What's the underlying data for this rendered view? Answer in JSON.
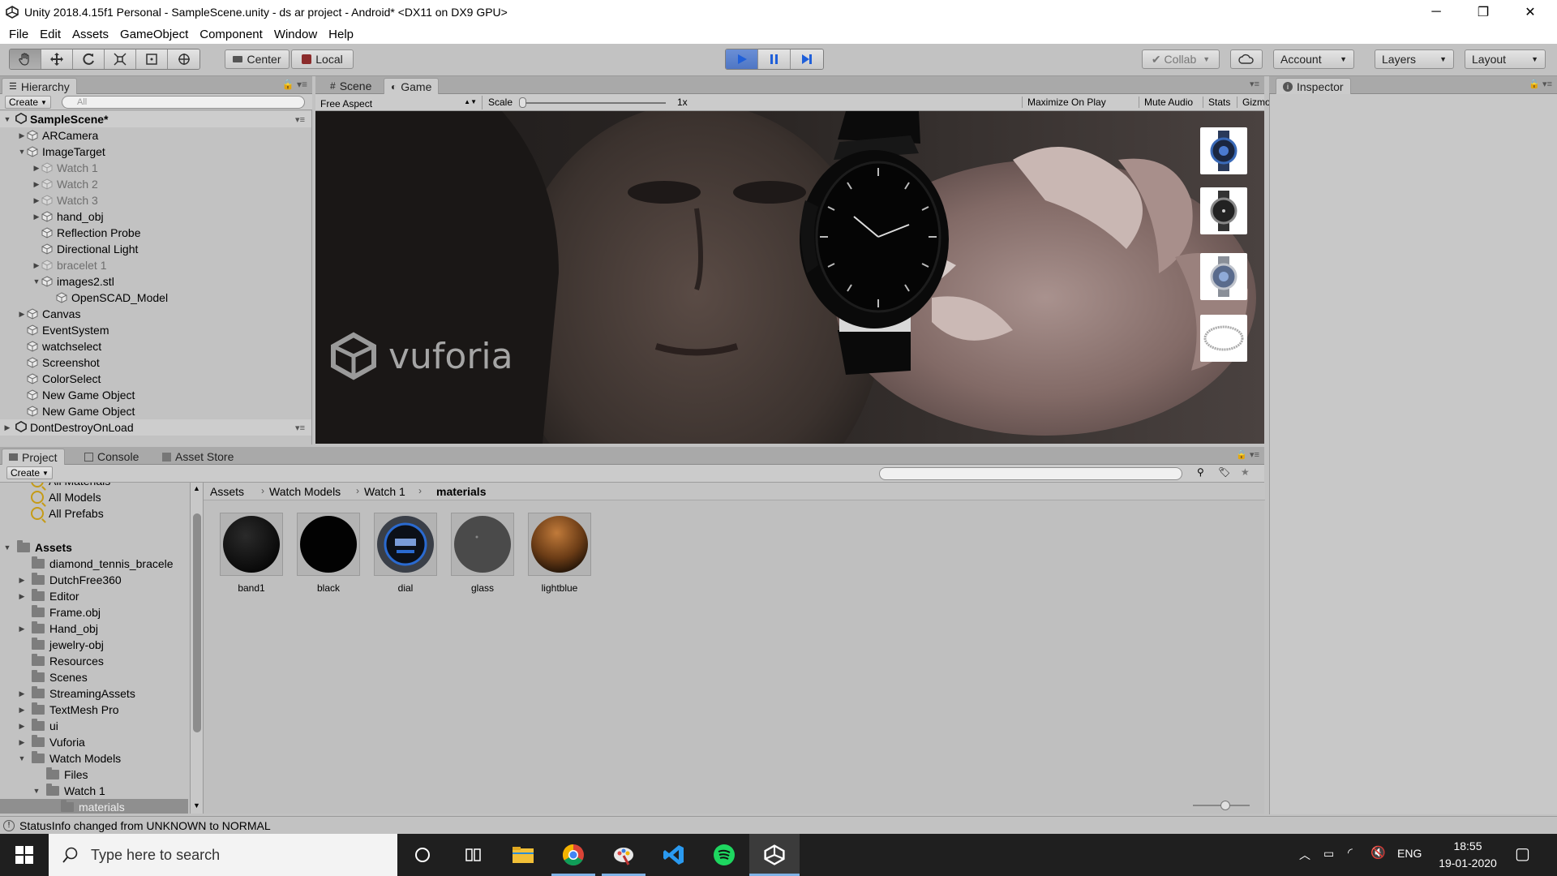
{
  "window": {
    "title": "Unity 2018.4.15f1 Personal - SampleScene.unity - ds ar project - Android* <DX11 on DX9 GPU>",
    "minimize": "─",
    "maximize": "❐",
    "close": "✕"
  },
  "menu": [
    "File",
    "Edit",
    "Assets",
    "GameObject",
    "Component",
    "Window",
    "Help"
  ],
  "toolbar": {
    "pivot": "Center",
    "space": "Local",
    "collab": "Collab",
    "account": "Account",
    "layers": "Layers",
    "layout": "Layout",
    "play_color": "#4f76c4"
  },
  "hierarchy": {
    "tab": "Hierarchy",
    "create": "Create",
    "search_placeholder": "All",
    "scene": "SampleScene*",
    "items": [
      {
        "label": "ARCamera",
        "indent": 1,
        "arrow": "right",
        "dim": false
      },
      {
        "label": "ImageTarget",
        "indent": 1,
        "arrow": "down",
        "dim": false
      },
      {
        "label": "Watch 1",
        "indent": 2,
        "arrow": "right",
        "dim": true
      },
      {
        "label": "Watch 2",
        "indent": 2,
        "arrow": "right",
        "dim": true
      },
      {
        "label": "Watch 3",
        "indent": 2,
        "arrow": "right",
        "dim": true
      },
      {
        "label": "hand_obj",
        "indent": 2,
        "arrow": "right",
        "dim": false
      },
      {
        "label": "Reflection Probe",
        "indent": 2,
        "arrow": "",
        "dim": false
      },
      {
        "label": "Directional Light",
        "indent": 2,
        "arrow": "",
        "dim": false
      },
      {
        "label": "bracelet 1",
        "indent": 2,
        "arrow": "right",
        "dim": true
      },
      {
        "label": "images2.stl",
        "indent": 2,
        "arrow": "down",
        "dim": false
      },
      {
        "label": "OpenSCAD_Model",
        "indent": 3,
        "arrow": "",
        "dim": false
      },
      {
        "label": "Canvas",
        "indent": 1,
        "arrow": "right",
        "dim": false
      },
      {
        "label": "EventSystem",
        "indent": 1,
        "arrow": "",
        "dim": false
      },
      {
        "label": "watchselect",
        "indent": 1,
        "arrow": "",
        "dim": false
      },
      {
        "label": "Screenshot",
        "indent": 1,
        "arrow": "",
        "dim": false
      },
      {
        "label": "ColorSelect",
        "indent": 1,
        "arrow": "",
        "dim": false
      },
      {
        "label": "New Game Object",
        "indent": 1,
        "arrow": "",
        "dim": false
      },
      {
        "label": "New Game Object",
        "indent": 1,
        "arrow": "",
        "dim": false
      }
    ],
    "dontdestroy": "DontDestroyOnLoad"
  },
  "center_tabs": {
    "scene": "Scene",
    "game": "Game"
  },
  "game_bar": {
    "aspect": "Free Aspect",
    "scale_label": "Scale",
    "scale_value": "1x",
    "maximize": "Maximize On Play",
    "mute": "Mute Audio",
    "stats": "Stats",
    "gizmos": "Gizmos"
  },
  "game_view": {
    "watermark": "vuforia"
  },
  "inspector": {
    "tab": "Inspector"
  },
  "project": {
    "tabs": {
      "project": "Project",
      "console": "Console",
      "asset_store": "Asset Store"
    },
    "create": "Create",
    "favorites": [
      "All Materials",
      "All Models",
      "All Prefabs"
    ],
    "assets_label": "Assets",
    "folders": [
      {
        "label": "diamond_tennis_bracele",
        "indent": 1,
        "arrow": ""
      },
      {
        "label": "DutchFree360",
        "indent": 1,
        "arrow": "right"
      },
      {
        "label": "Editor",
        "indent": 1,
        "arrow": "right"
      },
      {
        "label": "Frame.obj",
        "indent": 1,
        "arrow": ""
      },
      {
        "label": "Hand_obj",
        "indent": 1,
        "arrow": "right"
      },
      {
        "label": "jewelry-obj",
        "indent": 1,
        "arrow": ""
      },
      {
        "label": "Resources",
        "indent": 1,
        "arrow": ""
      },
      {
        "label": "Scenes",
        "indent": 1,
        "arrow": ""
      },
      {
        "label": "StreamingAssets",
        "indent": 1,
        "arrow": "right"
      },
      {
        "label": "TextMesh Pro",
        "indent": 1,
        "arrow": "right"
      },
      {
        "label": "ui",
        "indent": 1,
        "arrow": "right"
      },
      {
        "label": "Vuforia",
        "indent": 1,
        "arrow": "right"
      },
      {
        "label": "Watch Models",
        "indent": 1,
        "arrow": "down"
      },
      {
        "label": "Files",
        "indent": 2,
        "arrow": ""
      },
      {
        "label": "Watch 1",
        "indent": 2,
        "arrow": "down"
      },
      {
        "label": "materials",
        "indent": 3,
        "arrow": "",
        "selected": true
      }
    ],
    "breadcrumb": [
      "Assets",
      "Watch Models",
      "Watch 1",
      "materials"
    ],
    "assets": [
      {
        "label": "band1",
        "type": "band"
      },
      {
        "label": "black",
        "type": "black"
      },
      {
        "label": "dial",
        "type": "dial"
      },
      {
        "label": "glass",
        "type": "glass"
      },
      {
        "label": "lightblue",
        "type": "brown"
      }
    ]
  },
  "status": "StatusInfo changed from UNKNOWN to NORMAL",
  "taskbar": {
    "search_placeholder": "Type here to search",
    "lang": "ENG",
    "time": "18:55",
    "date": "19-01-2020"
  }
}
